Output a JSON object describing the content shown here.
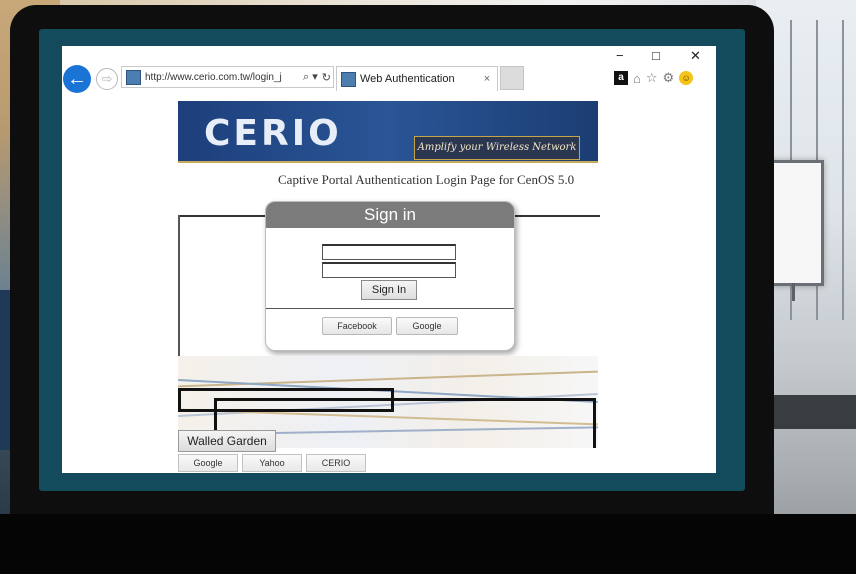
{
  "browser": {
    "url": "http://www.cerio.com.tw/login_j",
    "tab_title": "Web Authentication",
    "tab_close": "×",
    "minimize": "−",
    "maximize": "□",
    "close": "✕",
    "back_glyph": "←",
    "forward_glyph": "⇨",
    "search_glyph": "⌕ ▾",
    "refresh_glyph": "↻",
    "amazon_glyph": "a",
    "home_glyph": "⌂",
    "star_glyph": "☆",
    "gear_glyph": "⚙",
    "smiley_glyph": "☺"
  },
  "banner": {
    "logo": "CERIO",
    "tagline": "Amplify your Wireless Network"
  },
  "page": {
    "subtitle": "Captive Portal Authentication Login Page for CenOS 5.0"
  },
  "signin": {
    "title": "Sign in",
    "username_value": "",
    "password_value": "",
    "button": "Sign In",
    "facebook": "Facebook",
    "google": "Google"
  },
  "walled_garden": {
    "title": "Walled Garden",
    "links": [
      "Google",
      "Yahoo",
      "CERIO"
    ]
  },
  "colors": {
    "screen_bezel": "#134a5c",
    "banner_blue": "#1d3f7b",
    "back_button": "#1a74d6",
    "signin_header": "#7b7b7b"
  }
}
